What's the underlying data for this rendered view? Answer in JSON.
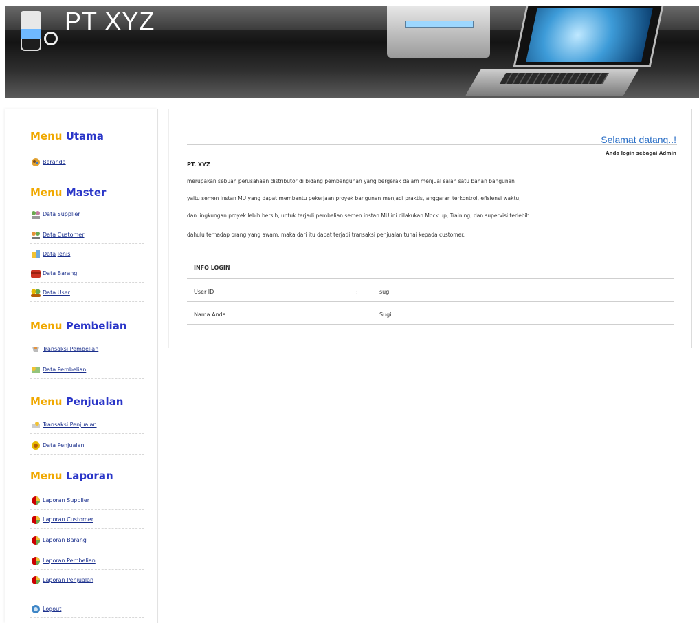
{
  "header": {
    "brand": "PT XYZ"
  },
  "sidebar": {
    "sections": [
      {
        "title_part1": "Menu",
        "title_part2": "Utama",
        "items": [
          {
            "label": "Beranda",
            "icon": "home-icon"
          }
        ]
      },
      {
        "title_part1": "Menu",
        "title_part2": "Master",
        "items": [
          {
            "label": "Data Supplier",
            "icon": "supplier-icon"
          },
          {
            "label": "Data Customer",
            "icon": "customer-icon"
          },
          {
            "label": "Data Jenis",
            "icon": "category-icon"
          },
          {
            "label": "Data Barang",
            "icon": "box-icon"
          },
          {
            "label": "Data User",
            "icon": "users-icon"
          }
        ]
      },
      {
        "title_part1": "Menu",
        "title_part2": "Pembelian",
        "items": [
          {
            "label": "Transaksi Pembelian",
            "icon": "purchase-transaction-icon"
          },
          {
            "label": "Data Pembelian",
            "icon": "purchase-data-icon"
          }
        ]
      },
      {
        "title_part1": "Menu",
        "title_part2": "Penjualan",
        "items": [
          {
            "label": "Transaksi Penjualan",
            "icon": "sales-transaction-icon"
          },
          {
            "label": "Data Penjualan",
            "icon": "sales-data-icon"
          }
        ]
      },
      {
        "title_part1": "Menu",
        "title_part2": "Laporan",
        "items": [
          {
            "label": "Laporan Supplier",
            "icon": "report-icon"
          },
          {
            "label": "Laporan Customer",
            "icon": "report-icon"
          },
          {
            "label": "Laporan Barang",
            "icon": "report-icon"
          },
          {
            "label": "Laporan Pembelian",
            "icon": "report-icon"
          },
          {
            "label": "Laporan Penjualan",
            "icon": "report-icon"
          }
        ]
      }
    ],
    "logout": {
      "label": "Logout",
      "icon": "logout-icon"
    }
  },
  "main": {
    "welcome": "Selamat datang..!",
    "login_as": "Anda login sebagai Admin",
    "company": "PT. XYZ",
    "description_lines": [
      "merupakan sebuah perusahaan distributor di bidang pembangunan yang bergerak dalam menjual salah satu bahan bangunan",
      "yaitu semen instan MU yang dapat membantu pekerjaan proyek bangunan menjadi praktis, anggaran terkontrol, efisiensi waktu,",
      "dan lingkungan proyek lebih bersih, untuk terjadi pembelian semen instan MU ini dilakukan Mock up, Training, dan supervisi terlebih",
      "dahulu terhadap orang yang awam, maka dari itu dapat terjadi transaksi penjualan tunai kepada customer."
    ],
    "info_login": {
      "heading": "INFO LOGIN",
      "rows": [
        {
          "label": "User ID",
          "sep": ":",
          "value": "sugi"
        },
        {
          "label": "Nama Anda",
          "sep": ":",
          "value": "Sugi"
        }
      ]
    }
  },
  "colors": {
    "menu_word": "#f0a800",
    "menu_accent": "#2a36c8",
    "link": "#1a2f8c",
    "welcome": "#2b6fc6"
  }
}
